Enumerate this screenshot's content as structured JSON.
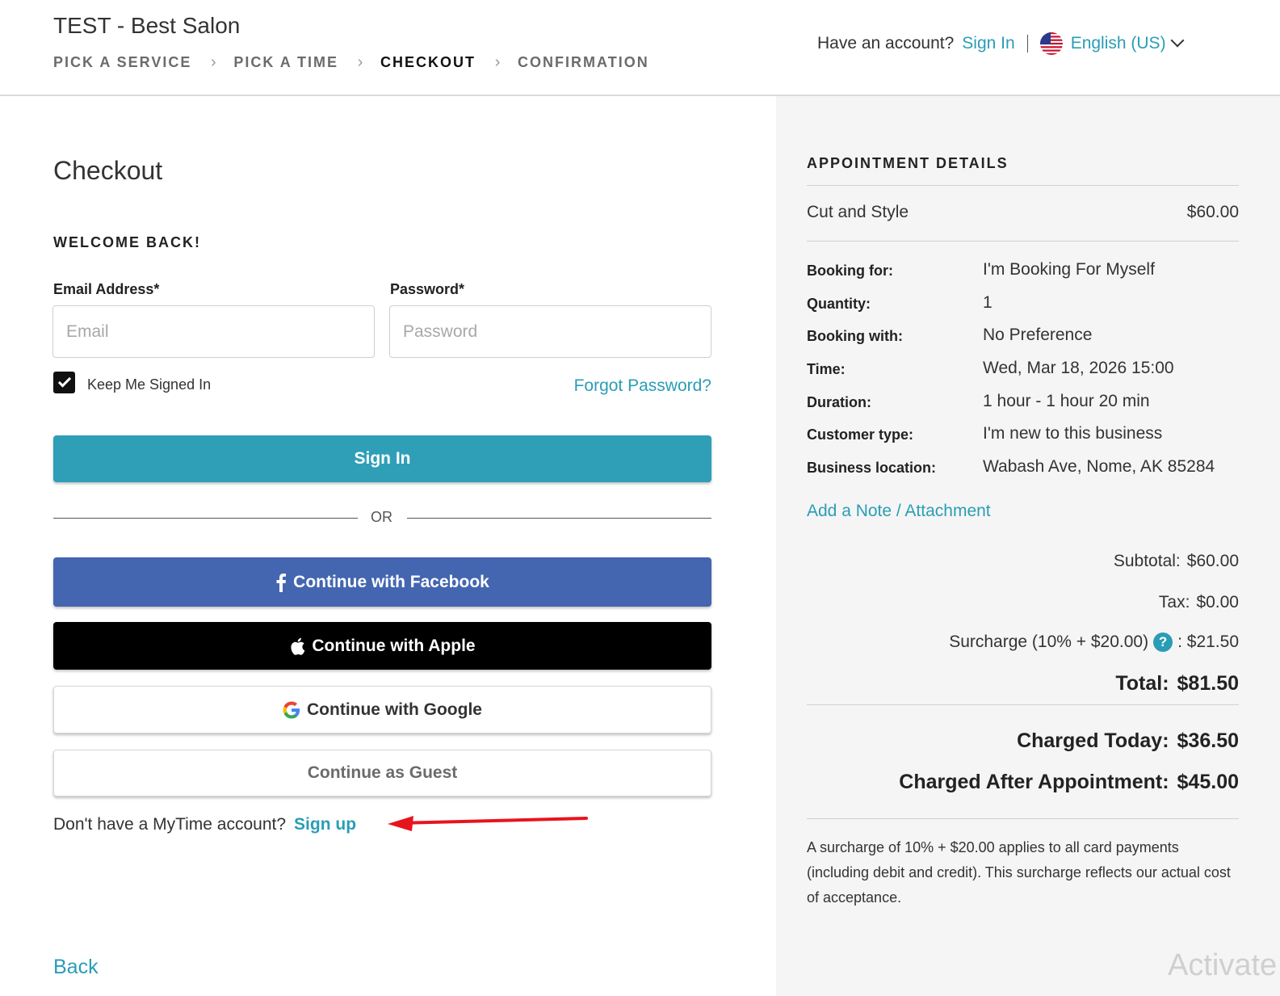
{
  "header": {
    "salon_name": "TEST - Best Salon",
    "steps": [
      "PICK A SERVICE",
      "PICK A TIME",
      "CHECKOUT",
      "CONFIRMATION"
    ],
    "active_step": "CHECKOUT",
    "account_prompt": "Have an account?",
    "sign_in": "Sign In",
    "language": "English (US)"
  },
  "main": {
    "title": "Checkout",
    "welcome": "WELCOME BACK!",
    "email_label": "Email Address*",
    "email_placeholder": "Email",
    "password_label": "Password*",
    "password_placeholder": "Password",
    "keep_signed_in": "Keep Me Signed In",
    "keep_signed_in_checked": true,
    "forgot_password": "Forgot Password?",
    "sign_in_button": "Sign In",
    "or": "OR",
    "facebook_button": "Continue with Facebook",
    "apple_button": "Continue with Apple",
    "google_button": "Continue with Google",
    "guest_button": "Continue as Guest",
    "no_account": "Don't have a MyTime account?",
    "sign_up": "Sign up",
    "back": "Back"
  },
  "appointment": {
    "title": "APPOINTMENT DETAILS",
    "service": "Cut and Style",
    "service_price": "$60.00",
    "details": [
      {
        "label": "Booking for:",
        "value": "I'm Booking For Myself"
      },
      {
        "label": "Quantity:",
        "value": "1"
      },
      {
        "label": "Booking with:",
        "value": "No Preference"
      },
      {
        "label": "Time:",
        "value": "Wed, Mar 18, 2026 15:00"
      },
      {
        "label": "Duration:",
        "value": "1 hour - 1 hour 20 min"
      },
      {
        "label": "Customer type:",
        "value": "I'm new to this business"
      },
      {
        "label": "Business location:",
        "value": "Wabash Ave, Nome, AK 85284"
      }
    ],
    "add_note": "Add a Note / Attachment",
    "subtotal_label": "Subtotal:",
    "subtotal": "$60.00",
    "tax_label": "Tax:",
    "tax": "$0.00",
    "surcharge_label": "Surcharge (10% + $20.00)",
    "surcharge": ": $21.50",
    "total_label": "Total:",
    "total": "$81.50",
    "charged_today_label": "Charged Today:",
    "charged_today": "$36.50",
    "charged_after_label": "Charged After Appointment:",
    "charged_after": "$45.00",
    "note": "A surcharge of 10% + $20.00 applies to all card payments (including debit and credit). This surcharge reflects our actual cost of acceptance."
  },
  "watermark": "Activate",
  "colors": {
    "accent": "#2a9db5",
    "facebook": "#4466b0",
    "apple": "#000000",
    "annotation_arrow": "#e8141c",
    "panel_bg": "#f5f5f5"
  }
}
